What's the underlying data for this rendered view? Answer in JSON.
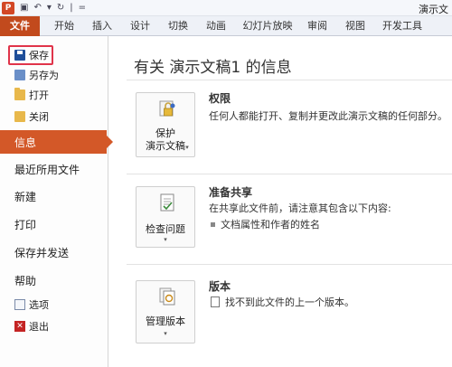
{
  "titlebar": {
    "app_icon_text": "P",
    "qat_glyphs": [
      "▣",
      "↶",
      "▾",
      "↻",
      "|",
      "="
    ],
    "window_title": "演示文"
  },
  "ribbon_tabs": [
    "文件",
    "开始",
    "插入",
    "设计",
    "切换",
    "动画",
    "幻灯片放映",
    "审阅",
    "视图",
    "开发工具"
  ],
  "left_nav": {
    "save": "保存",
    "save_as": "另存为",
    "open": "打开",
    "close": "关闭",
    "info": "信息",
    "recent": "最近所用文件",
    "new": "新建",
    "print": "打印",
    "save_send": "保存并发送",
    "help": "帮助",
    "options": "选项",
    "exit": "退出"
  },
  "main": {
    "title": "有关 演示文稿1 的信息",
    "permissions": {
      "button_line1": "保护",
      "button_line2": "演示文稿",
      "heading": "权限",
      "text": "任何人都能打开、复制并更改此演示文稿的任何部分。"
    },
    "prepare_share": {
      "button_label": "检查问题",
      "heading": "准备共享",
      "text": "在共享此文件前，请注意其包含以下内容:",
      "bullet": "文档属性和作者的姓名"
    },
    "versions": {
      "button_label": "管理版本",
      "heading": "版本",
      "text": "找不到此文件的上一个版本。"
    }
  },
  "colors": {
    "file_tab": "#c24a1d",
    "selected_nav": "#d35828",
    "highlight_box": "#e0344a"
  }
}
